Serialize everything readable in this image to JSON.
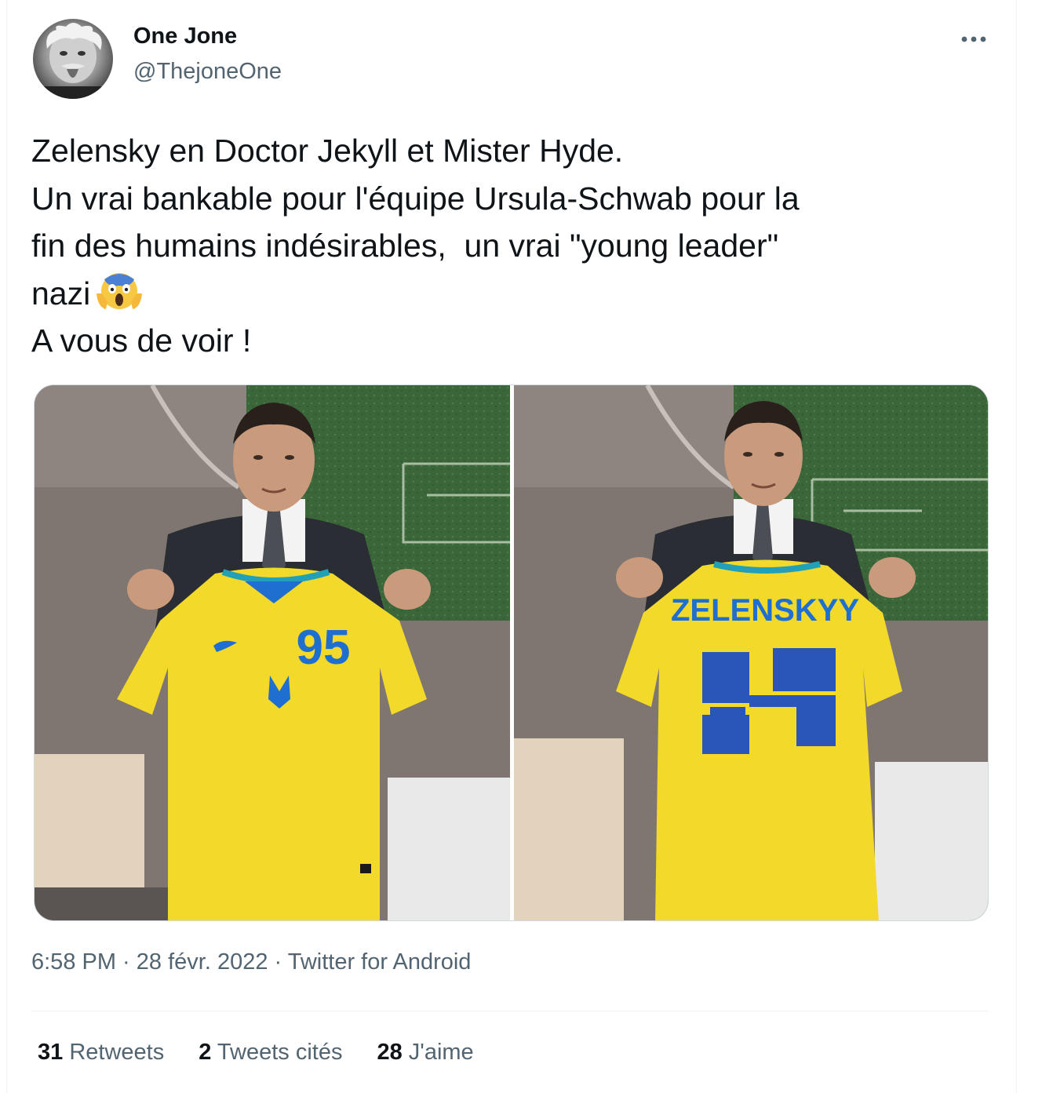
{
  "author": {
    "name": "One Jone",
    "handle": "@ThejoneOne",
    "avatar_icon": "avatar-photo"
  },
  "more_icon": "more-options-icon",
  "tweet": {
    "lines": [
      "Zelensky en Doctor Jekyll et Mister Hyde.",
      "Un vrai bankable pour l'équipe Ursula-Schwab pour la",
      "fin des humains indésirables,  un vrai \"young leader\"",
      "nazi",
      "A vous de voir !"
    ],
    "emoji": "face-screaming-in-fear-emoji"
  },
  "media": {
    "left": {
      "jersey_number": "95"
    },
    "right": {
      "jersey_name": "ZELENSKYY"
    }
  },
  "meta": {
    "time": "6:58 PM",
    "sep1": " · ",
    "date": "28 févr. 2022",
    "sep2": " · ",
    "source": "Twitter for Android"
  },
  "stats": {
    "retweets_count": "31",
    "retweets_label": " Retweets",
    "quotes_count": "2",
    "quotes_label": " Tweets cités",
    "likes_count": "28",
    "likes_label": " J'aime"
  },
  "colors": {
    "text": "#0f1419",
    "secondary": "#536471",
    "border": "#eff3f4",
    "jersey_yellow": "#f2d92a",
    "jersey_blue": "#1e6fd0"
  }
}
